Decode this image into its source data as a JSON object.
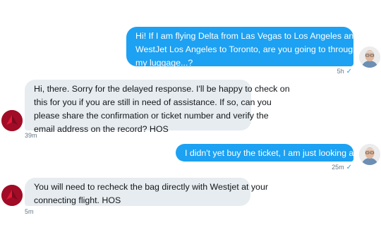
{
  "messages": [
    {
      "direction": "outgoing",
      "lines": [
        "Hi! If I am flying Delta from Las Vegas to Los Angeles and then",
        "WestJet Los Angeles to Toronto, are you going to through check",
        "my luggage...?"
      ],
      "time": "5h",
      "status_icon": "double-check-icon",
      "status_glyph": "✓"
    },
    {
      "direction": "incoming",
      "lines": [
        "Hi, there. Sorry for the delayed response. I'll be happy to check on",
        "this for you if you are still in need of assistance. If so, can you",
        "please share the confirmation or ticket number and verify the",
        "email address on the record? HOS"
      ],
      "time": "39m",
      "avatar_icon": "delta-logo-icon"
    },
    {
      "direction": "outgoing",
      "lines": [
        "I didn't yet buy the ticket, I am just looking at this..."
      ],
      "time": "25m",
      "status_icon": "double-check-icon",
      "status_glyph": "✓"
    },
    {
      "direction": "incoming",
      "lines": [
        "You will need to recheck the bag directly with Westjet at your",
        "connecting flight. HOS"
      ],
      "time": "5m",
      "avatar_icon": "delta-logo-icon"
    }
  ],
  "colors": {
    "outgoing_bubble": "#1da1f2",
    "incoming_bubble": "#e6ecf0",
    "delta_red": "#b8102b"
  }
}
